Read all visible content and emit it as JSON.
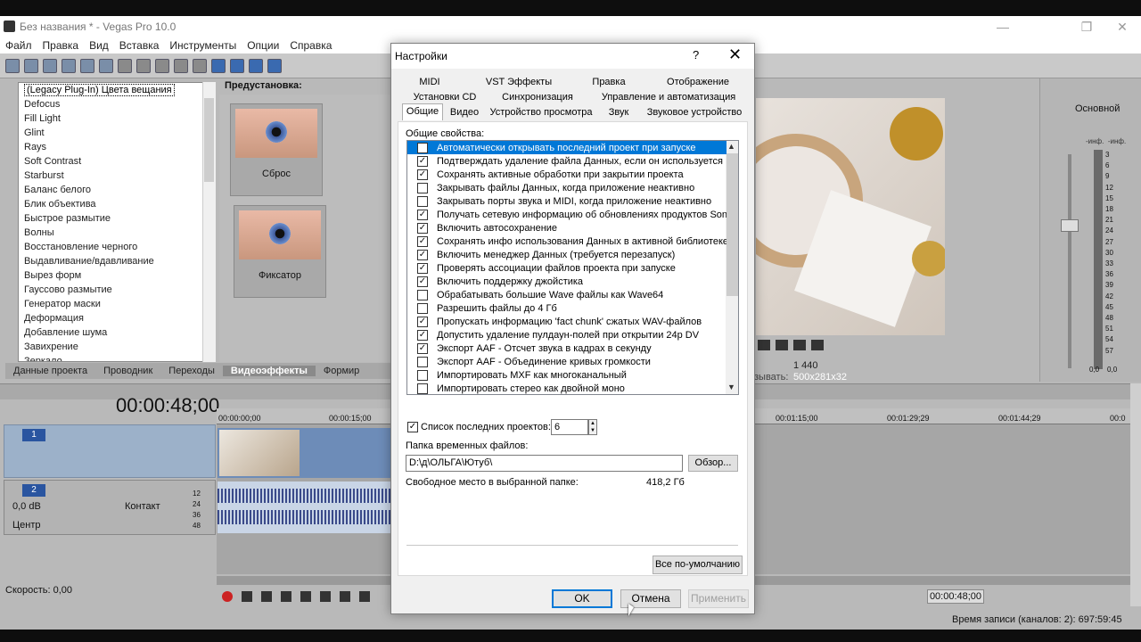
{
  "app": {
    "title": "Без названия * - Vegas Pro 10.0",
    "menu": [
      "Файл",
      "Правка",
      "Вид",
      "Вставка",
      "Инструменты",
      "Опции",
      "Справка"
    ]
  },
  "fx_list": [
    "(Legacy Plug-In) Цвета вещания",
    "Defocus",
    "Fill Light",
    "Glint",
    "Rays",
    "Soft Contrast",
    "Starburst",
    "Баланс белого",
    "Блик объектива",
    "Быстрое размытие",
    "Волны",
    "Восстановление черного",
    "Выдавливание/вдавливание",
    "Вырез форм",
    "Гауссово размытие",
    "Генератор маски",
    "Деформация",
    "Добавление шума",
    "Завихрение",
    "Зеркало"
  ],
  "presets": {
    "label": "Предустановка:",
    "items": [
      "Сброс",
      "Фиксатор"
    ]
  },
  "bottom_tabs": [
    "Данные проекта",
    "Проводник",
    "Переходы",
    "Видеоэффекты",
    "Формир"
  ],
  "preview": {
    "info_num": "1 440",
    "info_label": "зывать:",
    "info_val": "500x281x32"
  },
  "mixer": {
    "title": "Основной",
    "inf_left": "-инф.",
    "inf_right": "-инф.",
    "ticks": [
      "3",
      "6",
      "9",
      "12",
      "15",
      "18",
      "21",
      "24",
      "27",
      "30",
      "33",
      "36",
      "39",
      "42",
      "45",
      "48",
      "51",
      "54",
      "57"
    ],
    "bottom_left": "0,0",
    "bottom_right": "0,0"
  },
  "timeline": {
    "timecode": "00:00:48;00",
    "ruler": [
      "00:00:00;00",
      "00:00:15;00",
      "00:01:15;00",
      "00:01:29;29",
      "00:01:44;29",
      "00:0"
    ],
    "track1_num": "1",
    "track2_num": "2",
    "db": "0,0 dB",
    "center": "Центр",
    "kontakt": "Контакт",
    "meter_nums": [
      "12",
      "24",
      "36",
      "48"
    ],
    "speed": "Скорость: 0,00",
    "end_time": "00:00:48;00",
    "status": "Время записи (каналов: 2): 697:59:45"
  },
  "dialog": {
    "title": "Настройки",
    "help": "?",
    "close": "✕",
    "tabs_row1": [
      "MIDI",
      "VST Эффекты",
      "Правка",
      "Отображение"
    ],
    "tabs_row2": [
      "Установки CD",
      "Синхронизация",
      "Управление и автоматизация"
    ],
    "tabs_row3": [
      "Общие",
      "Видео",
      "Устройство просмотра",
      "Звук",
      "Звуковое устройство"
    ],
    "general_label": "Общие свойства:",
    "options": [
      {
        "label": "Автоматически открывать последний проект при запуске",
        "checked": false,
        "highlight": true
      },
      {
        "label": "Подтверждать удаление файла Данных, если он используется",
        "checked": true
      },
      {
        "label": "Сохранять активные обработки при закрытии проекта",
        "checked": true
      },
      {
        "label": "Закрывать файлы Данных, когда приложение неактивно",
        "checked": false
      },
      {
        "label": "Закрывать порты звука и MIDI, когда приложение неактивно",
        "checked": false
      },
      {
        "label": "Получать сетевую информацию об обновлениях продуктов Sony",
        "checked": true
      },
      {
        "label": "Включить автосохранение",
        "checked": true
      },
      {
        "label": "Сохранять инфо использования Данных в активной библиотеке Да",
        "checked": true
      },
      {
        "label": "Включить менеджер Данных (требуется перезапуск)",
        "checked": true
      },
      {
        "label": "Проверять ассоциации файлов проекта при запуске",
        "checked": true
      },
      {
        "label": "Включить поддержку джойстика",
        "checked": true
      },
      {
        "label": "Обрабатывать большие Wave файлы как Wave64",
        "checked": false
      },
      {
        "label": "Разрешить файлы до 4 Гб",
        "checked": false
      },
      {
        "label": "Пропускать информацию 'fact chunk' сжатых WAV-файлов",
        "checked": true
      },
      {
        "label": "Допустить удаление пулдаун-полей при открытии 24p DV",
        "checked": true
      },
      {
        "label": "Экспорт AAF - Отсчет звука в кадрах в секунду",
        "checked": true
      },
      {
        "label": "Экспорт AAF - Объединение кривых громкости",
        "checked": false
      },
      {
        "label": "Импортировать MXF как многоканальный",
        "checked": false
      },
      {
        "label": "Импортировать стерео как двойной моно",
        "checked": false
      }
    ],
    "recent_label": "Список последних проектов:",
    "recent_value": "6",
    "temp_label": "Папка временных файлов:",
    "temp_value": "D:\\д\\ОЛЬГА\\Ютуб\\",
    "browse": "Обзор...",
    "free_label": "Свободное место в выбранной папке:",
    "free_value": "418,2 Гб",
    "defaults": "Все по-умолчанию",
    "ok": "OK",
    "cancel": "Отмена",
    "apply": "Применить"
  }
}
